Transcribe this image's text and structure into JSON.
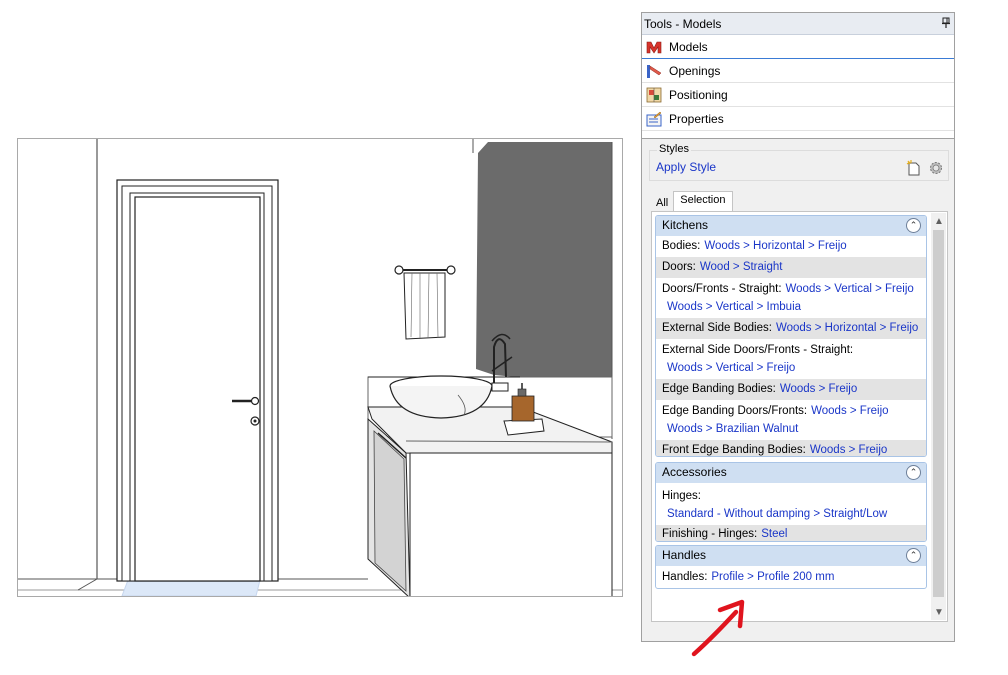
{
  "panel": {
    "title": "Tools - Models",
    "nav": [
      {
        "label": "Models",
        "icon": "models-icon"
      },
      {
        "label": "Openings",
        "icon": "openings-icon"
      },
      {
        "label": "Positioning",
        "icon": "positioning-icon"
      },
      {
        "label": "Properties",
        "icon": "properties-icon"
      }
    ],
    "styles": {
      "legend": "Styles",
      "apply_label": "Apply Style"
    },
    "tabs": {
      "all": "All",
      "selection": "Selection"
    },
    "sections": {
      "kitchens": {
        "title": "Kitchens",
        "rows": {
          "bodies": {
            "label": "Bodies:",
            "value": "Woods > Horizontal > Freijo"
          },
          "doors": {
            "label": "Doors:",
            "value": "Wood > Straight"
          },
          "doors_fronts": {
            "label": "Doors/Fronts - Straight:",
            "value": "Woods > Vertical > Freijo",
            "value2": "Woods > Vertical > Imbuia"
          },
          "external_side_bodies": {
            "label": "External Side Bodies:",
            "value": "Woods > Horizontal > Freijo"
          },
          "external_side_doors": {
            "label": "External Side Doors/Fronts - Straight:",
            "value": "Woods > Vertical > Freijo"
          },
          "edge_banding_bodies": {
            "label": "Edge Banding Bodies:",
            "value": "Woods > Freijo"
          },
          "edge_banding_doors": {
            "label": "Edge Banding Doors/Fronts:",
            "value": "Woods > Freijo",
            "value2": "Woods > Brazilian Walnut"
          },
          "front_edge_banding": {
            "label": "Front Edge Banding Bodies:",
            "value": "Woods > Freijo"
          }
        }
      },
      "accessories": {
        "title": "Accessories",
        "rows": {
          "hinges": {
            "label": "Hinges:",
            "value": "Standard - Without damping > Straight/Low"
          },
          "finishing_hinges": {
            "label": "Finishing - Hinges:",
            "value": "Steel"
          }
        }
      },
      "handles": {
        "title": "Handles",
        "rows": {
          "handles": {
            "label": "Handles:",
            "value": "Profile > Profile 200 mm"
          }
        }
      }
    }
  },
  "colors": {
    "link": "#1a36c8",
    "section_header": "#cfdff2",
    "arrow": "#e0141e",
    "wall_dark": "#6b6b6b"
  }
}
